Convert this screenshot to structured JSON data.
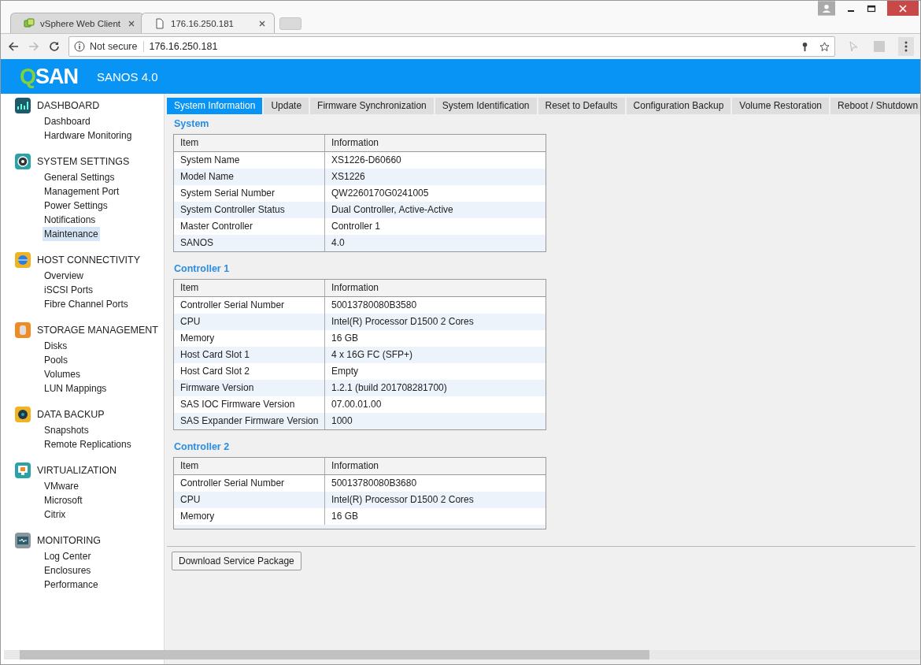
{
  "browser": {
    "tabs": [
      {
        "title": "vSphere Web Client",
        "selected": false
      },
      {
        "title": "176.16.250.181",
        "selected": true
      }
    ],
    "address": {
      "security": "Not secure",
      "url": "176.16.250.181"
    }
  },
  "header": {
    "logo": "QSAN",
    "version": "SANOS 4.0"
  },
  "sidebar": {
    "sections": [
      {
        "title": "DASHBOARD",
        "items": [
          {
            "label": "Dashboard",
            "selected": false
          },
          {
            "label": "Hardware Monitoring",
            "selected": false
          }
        ]
      },
      {
        "title": "SYSTEM SETTINGS",
        "items": [
          {
            "label": "General Settings",
            "selected": false
          },
          {
            "label": "Management Port",
            "selected": false
          },
          {
            "label": "Power Settings",
            "selected": false
          },
          {
            "label": "Notifications",
            "selected": false
          },
          {
            "label": "Maintenance",
            "selected": true
          }
        ]
      },
      {
        "title": "HOST CONNECTIVITY",
        "items": [
          {
            "label": "Overview",
            "selected": false
          },
          {
            "label": "iSCSI Ports",
            "selected": false
          },
          {
            "label": "Fibre Channel Ports",
            "selected": false
          }
        ]
      },
      {
        "title": "STORAGE MANAGEMENT",
        "items": [
          {
            "label": "Disks",
            "selected": false
          },
          {
            "label": "Pools",
            "selected": false
          },
          {
            "label": "Volumes",
            "selected": false
          },
          {
            "label": "LUN Mappings",
            "selected": false
          }
        ]
      },
      {
        "title": "DATA BACKUP",
        "items": [
          {
            "label": "Snapshots",
            "selected": false
          },
          {
            "label": "Remote Replications",
            "selected": false
          }
        ]
      },
      {
        "title": "VIRTUALIZATION",
        "items": [
          {
            "label": "VMware",
            "selected": false
          },
          {
            "label": "Microsoft",
            "selected": false
          },
          {
            "label": "Citrix",
            "selected": false
          }
        ]
      },
      {
        "title": "MONITORING",
        "items": [
          {
            "label": "Log Center",
            "selected": false
          },
          {
            "label": "Enclosures",
            "selected": false
          },
          {
            "label": "Performance",
            "selected": false
          }
        ]
      }
    ]
  },
  "tabs": [
    {
      "label": "System Information",
      "selected": true
    },
    {
      "label": "Update",
      "selected": false
    },
    {
      "label": "Firmware Synchronization",
      "selected": false
    },
    {
      "label": "System Identification",
      "selected": false
    },
    {
      "label": "Reset to Defaults",
      "selected": false
    },
    {
      "label": "Configuration Backup",
      "selected": false
    },
    {
      "label": "Volume Restoration",
      "selected": false
    },
    {
      "label": "Reboot / Shutdown",
      "selected": false
    }
  ],
  "sections": [
    {
      "title": "System",
      "columns": [
        "Item",
        "Information"
      ],
      "clipped": false,
      "rows": [
        [
          "System Name",
          "XS1226-D60660"
        ],
        [
          "Model Name",
          "XS1226"
        ],
        [
          "System Serial Number",
          "QW2260170G0241005"
        ],
        [
          "System Controller Status",
          "Dual Controller, Active-Active"
        ],
        [
          "Master Controller",
          "Controller 1"
        ],
        [
          "SANOS",
          "4.0"
        ]
      ]
    },
    {
      "title": "Controller 1",
      "columns": [
        "Item",
        "Information"
      ],
      "clipped": false,
      "rows": [
        [
          "Controller Serial Number",
          "50013780080B3580"
        ],
        [
          "CPU",
          "Intel(R) Processor D1500 2 Cores"
        ],
        [
          "Memory",
          "16 GB"
        ],
        [
          "Host Card Slot 1",
          "4 x 16G FC (SFP+)"
        ],
        [
          "Host Card Slot 2",
          "Empty"
        ],
        [
          "Firmware Version",
          "1.2.1 (build 201708281700)"
        ],
        [
          "SAS IOC Firmware Version",
          "07.00.01.00"
        ],
        [
          "SAS Expander Firmware Version",
          "1000"
        ]
      ]
    },
    {
      "title": "Controller 2",
      "columns": [
        "Item",
        "Information"
      ],
      "clipped": true,
      "rows": [
        [
          "Controller Serial Number",
          "50013780080B3680"
        ],
        [
          "CPU",
          "Intel(R) Processor D1500 2 Cores"
        ],
        [
          "Memory",
          "16 GB"
        ]
      ]
    }
  ],
  "button": "Download Service Package"
}
